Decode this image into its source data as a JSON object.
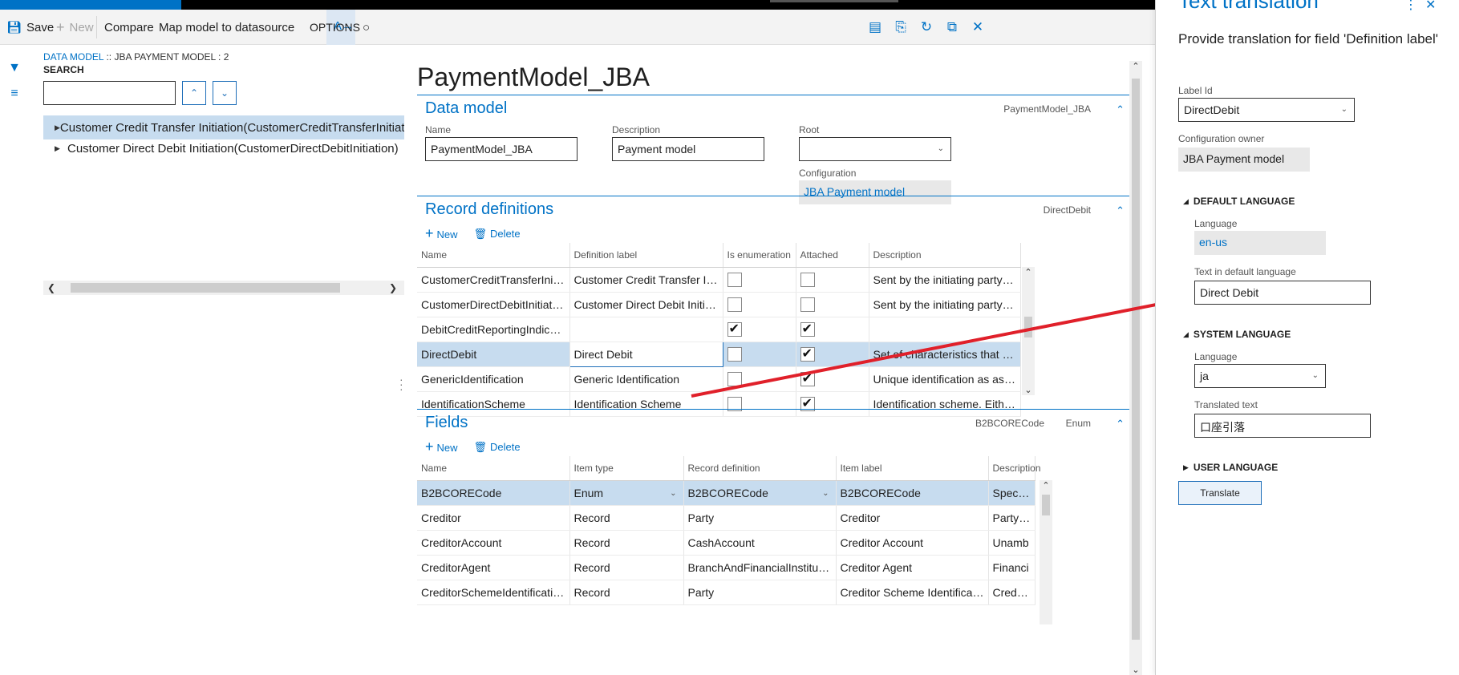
{
  "toolbar": {
    "save": "Save",
    "new": "New",
    "compare": "Compare",
    "map": "Map model to datasource",
    "options": "OPTIONS",
    "icons": [
      "translate-icon",
      "lightbulb-icon",
      "office-icon",
      "attach-icon",
      "refresh-icon",
      "popout-icon",
      "close-icon"
    ]
  },
  "nav": {
    "breadcrumb_link": "DATA MODEL",
    "breadcrumb_rest": " :: JBA PAYMENT MODEL : 2",
    "search_label": "SEARCH",
    "search_value": "",
    "tree": [
      {
        "label": "Customer Credit Transfer Initiation(CustomerCreditTransferInitiat"
      },
      {
        "label": "Customer Direct Debit Initiation(CustomerDirectDebitInitiation)"
      }
    ]
  },
  "main": {
    "title": "PaymentModel_JBA",
    "data_model": {
      "title": "Data model",
      "summary": "PaymentModel_JBA",
      "name_label": "Name",
      "name_value": "PaymentModel_JBA",
      "desc_label": "Description",
      "desc_value": "Payment model",
      "root_label": "Root",
      "root_value": "",
      "config_label": "Configuration",
      "config_value": "JBA Payment model"
    },
    "records": {
      "title": "Record definitions",
      "summary": "DirectDebit",
      "new": "New",
      "delete": "Delete",
      "columns": [
        "Name",
        "Definition label",
        "Is enumeration",
        "Attached",
        "Description"
      ],
      "rows": [
        {
          "name": "CustomerCreditTransferInitiation",
          "label": "Customer Credit Transfer Initiati...",
          "enum": false,
          "attached": false,
          "desc": "Sent by the initiating party to th..."
        },
        {
          "name": "CustomerDirectDebitInitiation",
          "label": "Customer Direct Debit Initiation",
          "enum": false,
          "attached": false,
          "desc": "Sent by the initiating party to th..."
        },
        {
          "name": "DebitCreditReportingIndicator",
          "label": "",
          "enum": true,
          "attached": true,
          "desc": ""
        },
        {
          "name": "DirectDebit",
          "label": "Direct Debit",
          "enum": false,
          "attached": true,
          "desc": "Set of characteristics that apply to"
        },
        {
          "name": "GenericIdentification",
          "label": "Generic Identification",
          "enum": false,
          "attached": true,
          "desc": "Unique identification as assigne..."
        },
        {
          "name": "IdentificationScheme",
          "label": "Identification Scheme",
          "enum": false,
          "attached": true,
          "desc": "Identification scheme. Either Co..."
        }
      ]
    },
    "fields": {
      "title": "Fields",
      "summary1": "B2BCORECode",
      "summary2": "Enum",
      "new": "New",
      "delete": "Delete",
      "columns": [
        "Name",
        "Item type",
        "Record definition",
        "Item label",
        "Description"
      ],
      "rows": [
        {
          "name": "B2BCORECode",
          "type": "Enum",
          "record": "B2BCORECode",
          "label": "B2BCORECode",
          "desc": "Specifie"
        },
        {
          "name": "Creditor",
          "type": "Record",
          "record": "Party",
          "label": "Creditor",
          "desc": "Party to"
        },
        {
          "name": "CreditorAccount",
          "type": "Record",
          "record": "CashAccount",
          "label": "Creditor Account",
          "desc": "Unamb"
        },
        {
          "name": "CreditorAgent",
          "type": "Record",
          "record": "BranchAndFinancialInstitution",
          "label": "Creditor Agent",
          "desc": "Financi"
        },
        {
          "name": "CreditorSchemeIdentification",
          "type": "Record",
          "record": "Party",
          "label": "Creditor Scheme Identification",
          "desc": "Credit p"
        }
      ]
    }
  },
  "panel": {
    "title": "Text translation",
    "description": "Provide translation for field 'Definition label'",
    "label_id_label": "Label Id",
    "label_id_value": "DirectDebit",
    "owner_label": "Configuration owner",
    "owner_value": "JBA Payment model",
    "default_group": "DEFAULT LANGUAGE",
    "default_lang_label": "Language",
    "default_lang_value": "en-us",
    "default_text_label": "Text in default language",
    "default_text_value": "Direct Debit",
    "system_group": "SYSTEM LANGUAGE",
    "system_lang_label": "Language",
    "system_lang_value": "ja",
    "translated_label": "Translated text",
    "translated_value": "口座引落",
    "user_group": "USER LANGUAGE",
    "translate_button": "Translate"
  },
  "colors": {
    "accent": "#0072c6",
    "selection": "#c7dcef",
    "annotation": "#e0202a"
  }
}
